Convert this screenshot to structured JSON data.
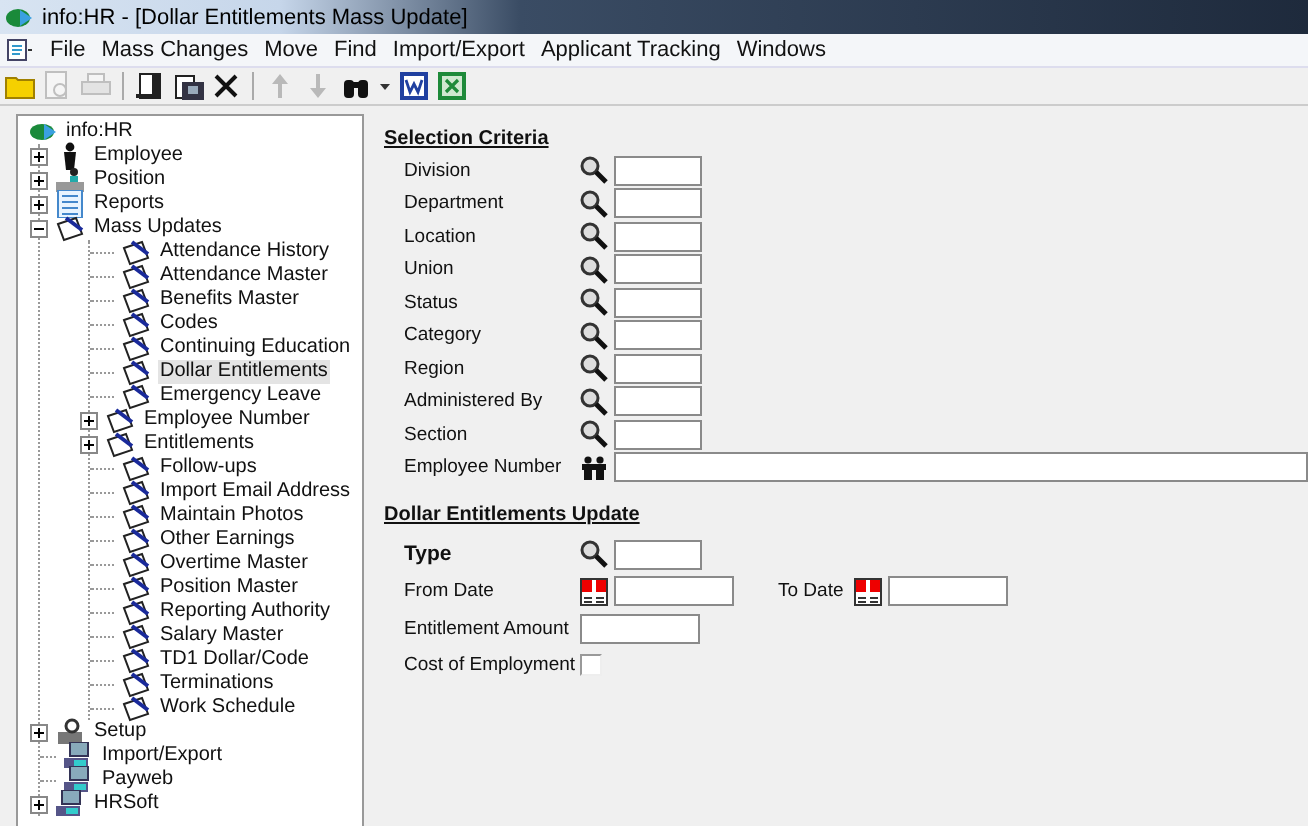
{
  "window": {
    "title": "info:HR - [Dollar Entitlements Mass Update]"
  },
  "menu": [
    "File",
    "Mass Changes",
    "Move",
    "Find",
    "Import/Export",
    "Applicant Tracking",
    "Windows"
  ],
  "toolbar": [
    {
      "kind": "folder",
      "disabled": false
    },
    {
      "kind": "preview",
      "disabled": true
    },
    {
      "kind": "print",
      "disabled": true
    },
    {
      "kind": "separator"
    },
    {
      "kind": "document",
      "disabled": false
    },
    {
      "kind": "save",
      "disabled": false
    },
    {
      "kind": "delete",
      "disabled": false
    },
    {
      "kind": "separator"
    },
    {
      "kind": "up",
      "disabled": true
    },
    {
      "kind": "down",
      "disabled": true
    },
    {
      "kind": "binoculars",
      "disabled": false
    },
    {
      "kind": "caret",
      "disabled": false
    },
    {
      "kind": "word",
      "disabled": false
    },
    {
      "kind": "excel",
      "disabled": false
    }
  ],
  "tree": {
    "label": "info:HR",
    "selected": false,
    "children": [
      {
        "label": "Employee",
        "kind": "person",
        "expanded": false,
        "selected": false
      },
      {
        "label": "Position",
        "kind": "position",
        "expanded": false,
        "selected": false
      },
      {
        "label": "Reports",
        "kind": "report",
        "expanded": false,
        "selected": false
      },
      {
        "label": "Mass Updates",
        "kind": "mass",
        "expanded": true,
        "selected": false,
        "children": [
          {
            "label": "Attendance History",
            "selected": false
          },
          {
            "label": "Attendance Master",
            "selected": false
          },
          {
            "label": "Benefits Master",
            "selected": false
          },
          {
            "label": "Codes",
            "selected": false
          },
          {
            "label": "Continuing Education",
            "selected": false
          },
          {
            "label": "Dollar Entitlements",
            "selected": true
          },
          {
            "label": "Emergency Leave",
            "selected": false
          },
          {
            "label": "Employee Number",
            "expanded": false,
            "selected": false
          },
          {
            "label": "Entitlements",
            "expanded": false,
            "selected": false
          },
          {
            "label": "Follow-ups",
            "selected": false
          },
          {
            "label": "Import Email Address",
            "selected": false
          },
          {
            "label": "Maintain Photos",
            "selected": false
          },
          {
            "label": "Other Earnings",
            "selected": false
          },
          {
            "label": "Overtime Master",
            "selected": false
          },
          {
            "label": "Position Master",
            "selected": false
          },
          {
            "label": "Reporting Authority",
            "selected": false
          },
          {
            "label": "Salary Master",
            "selected": false
          },
          {
            "label": "TD1 Dollar/Code",
            "selected": false
          },
          {
            "label": "Terminations",
            "selected": false
          },
          {
            "label": "Work Schedule",
            "selected": false
          }
        ]
      },
      {
        "label": "Setup",
        "kind": "setup",
        "expanded": false,
        "selected": false
      },
      {
        "label": "Import/Export",
        "kind": "network",
        "selected": false
      },
      {
        "label": "Payweb",
        "kind": "network",
        "selected": false
      },
      {
        "label": "HRSoft",
        "kind": "network",
        "expanded": false,
        "selected": false
      }
    ]
  },
  "selection_criteria": {
    "heading": "Selection Criteria",
    "fields": [
      {
        "label": "Division",
        "kind": "lookup"
      },
      {
        "label": "Department",
        "kind": "lookup"
      },
      {
        "label": "Location",
        "kind": "lookup"
      },
      {
        "label": "Union",
        "kind": "lookup"
      },
      {
        "label": "Status",
        "kind": "lookup"
      },
      {
        "label": "Category",
        "kind": "lookup"
      },
      {
        "label": "Region",
        "kind": "lookup"
      },
      {
        "label": "Administered By",
        "kind": "lookup"
      },
      {
        "label": "Section",
        "kind": "lookup"
      },
      {
        "label": "Employee Number",
        "kind": "employee"
      }
    ]
  },
  "update": {
    "heading": "Dollar Entitlements Update",
    "fields": [
      {
        "label": "Type",
        "kind": "lookup",
        "required": true
      },
      {
        "label": "From Date",
        "kind": "date_range",
        "required": false,
        "to_label": "To Date"
      },
      {
        "label": "Entitlement Amount",
        "kind": "amount",
        "required": false
      },
      {
        "label": "Cost of Employment",
        "kind": "checkbox",
        "required": false,
        "checked": false
      }
    ]
  }
}
